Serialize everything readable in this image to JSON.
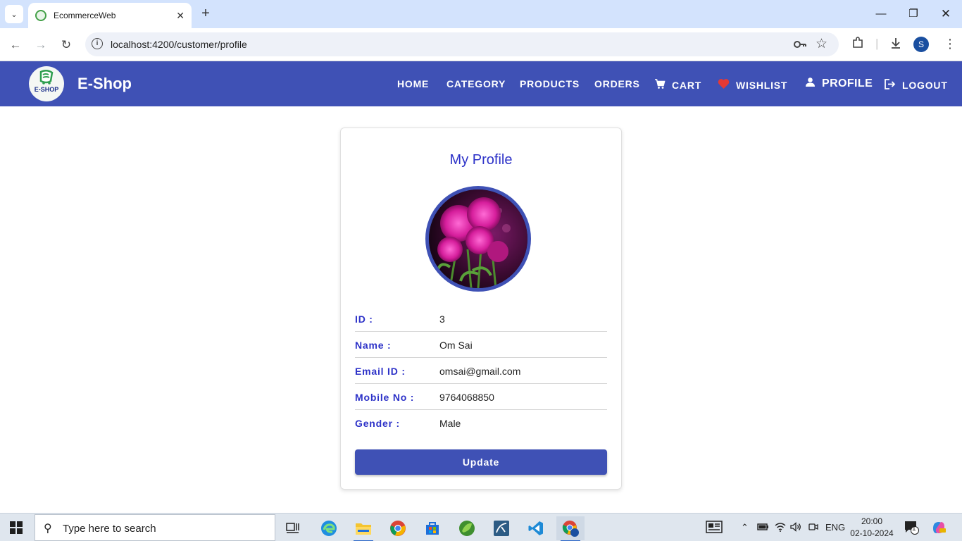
{
  "browser": {
    "tab_title": "EcommerceWeb",
    "url": "localhost:4200/customer/profile",
    "profile_initial": "S"
  },
  "navbar": {
    "brand": "E-Shop",
    "logo_text": "E-SHOP",
    "links": {
      "home": "HOME",
      "category": "CATEGORY",
      "products": "PRODUCTS",
      "orders": "ORDERS",
      "cart": "CART",
      "wishlist": "WISHLIST",
      "profile": "PROFILE",
      "logout": "LOGOUT"
    }
  },
  "profile": {
    "title": "My Profile",
    "fields": [
      {
        "label": "ID :",
        "value": "3"
      },
      {
        "label": "Name :",
        "value": "Om Sai"
      },
      {
        "label": "Email ID :",
        "value": "omsai@gmail.com"
      },
      {
        "label": "Mobile No :",
        "value": "9764068850"
      },
      {
        "label": "Gender :",
        "value": "Male"
      }
    ],
    "update_label": "Update"
  },
  "taskbar": {
    "search_placeholder": "Type here to search",
    "language": "ENG",
    "time": "20:00",
    "date": "02-10-2024",
    "notification_count": "1"
  },
  "colors": {
    "primary": "#3f51b5",
    "label": "#2d32c8",
    "wishlist_heart": "#e53935"
  },
  "icons": {
    "cart": "cart-icon",
    "wishlist": "heart-icon",
    "profile": "person-icon",
    "logout": "logout-icon"
  }
}
